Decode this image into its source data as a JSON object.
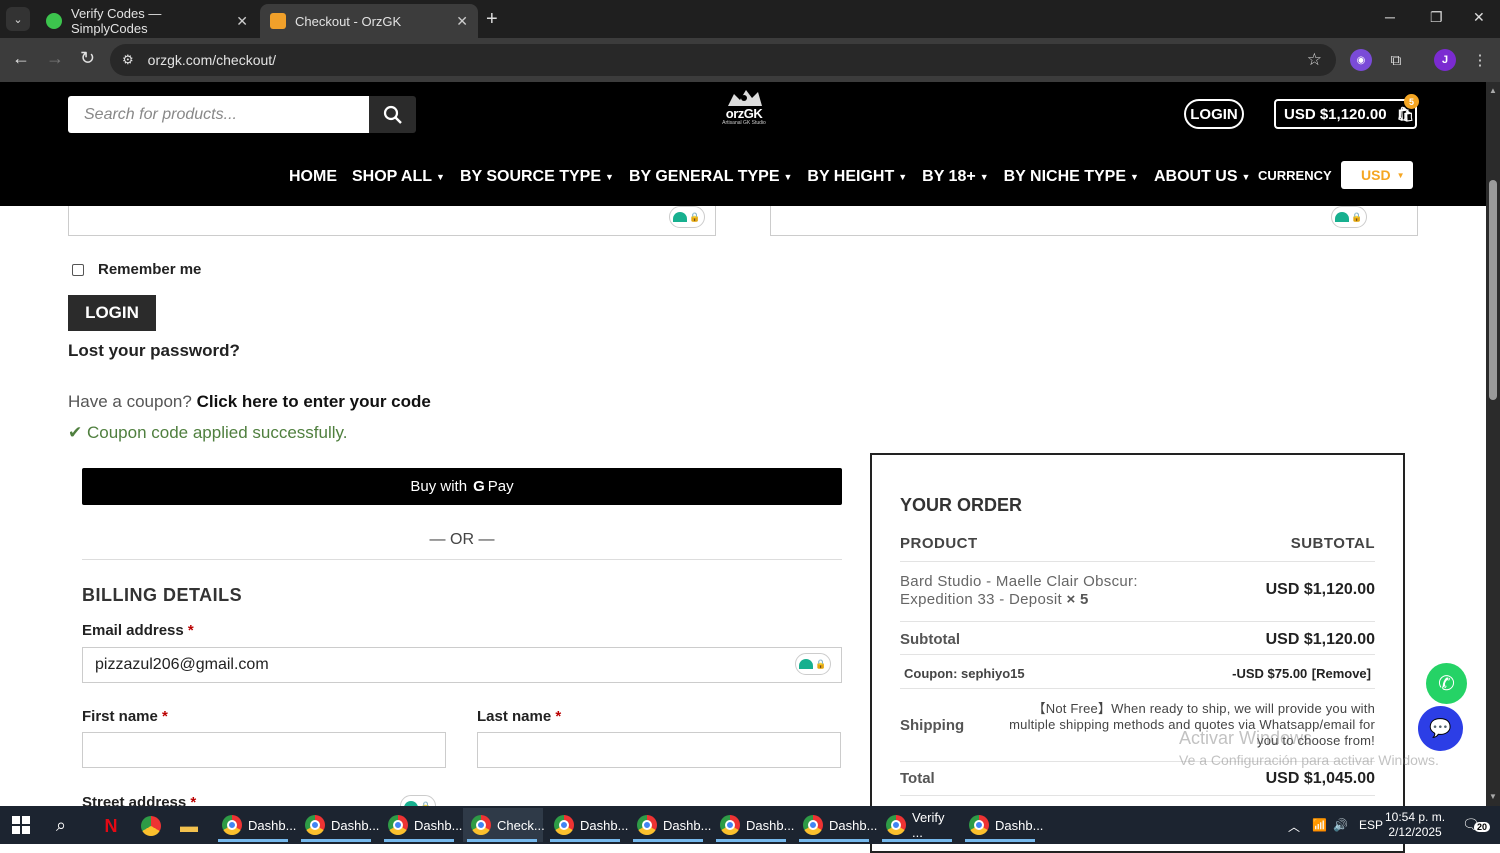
{
  "browser": {
    "tabs": [
      {
        "title": "Verify Codes — SimplyCodes",
        "favicon_color": "#3cc44d"
      },
      {
        "title": "Checkout - OrzGK",
        "favicon_color": "#f0a02a"
      }
    ],
    "url": "orzgk.com/checkout/",
    "profile_initial": "J"
  },
  "header": {
    "search_placeholder": "Search for products...",
    "logo_name": "orzGK",
    "logo_tagline": "Artisanal GK Studio",
    "login_label": "LOGIN",
    "cart_total": "USD $1,120.00",
    "cart_count": "5",
    "nav": [
      "HOME",
      "SHOP ALL",
      "BY SOURCE TYPE",
      "BY GENERAL TYPE",
      "BY HEIGHT",
      "BY 18+",
      "BY NICHE TYPE",
      "ABOUT US"
    ],
    "nav_has_caret": [
      false,
      true,
      true,
      true,
      true,
      true,
      true,
      true
    ],
    "currency_label": "CURRENCY",
    "currency_value": "USD"
  },
  "login_form": {
    "remember_label": "Remember me",
    "login_button": "LOGIN",
    "lost_password": "Lost your password?"
  },
  "coupon": {
    "question": "Have a coupon?",
    "link": "Click here to enter your code",
    "success": "Coupon code applied successfully."
  },
  "payment": {
    "gpay_prefix": "Buy with",
    "gpay_g": "G",
    "gpay_suffix": "Pay",
    "or_text": "— OR —"
  },
  "billing": {
    "title": "BILLING DETAILS",
    "email_label": "Email address",
    "email_value": "pizzazul206@gmail.com",
    "first_name_label": "First name",
    "last_name_label": "Last name",
    "street_label": "Street address",
    "required_mark": "*"
  },
  "order": {
    "title": "YOUR ORDER",
    "col_product": "PRODUCT",
    "col_subtotal": "SUBTOTAL",
    "item_name": "Bard Studio - Maelle Clair Obscur: Expedition 33 - Deposit",
    "item_qty": "× 5",
    "item_total": "USD $1,120.00",
    "subtotal_label": "Subtotal",
    "subtotal_value": "USD $1,120.00",
    "coupon_label": "Coupon: sephiyo15",
    "coupon_value": "-USD $75.00",
    "coupon_remove": "[Remove]",
    "shipping_label": "Shipping",
    "shipping_note": "【Not Free】When ready to ship, we will provide you with multiple shipping methods and quotes via Whatsapp/email for you to choose from!",
    "total_label": "Total",
    "total_value": "USD $1,045.00"
  },
  "watermark": {
    "line1": "Activar Windows",
    "line2": "Ve a Configuración para activar Windows."
  },
  "taskbar": {
    "apps": [
      {
        "label": "Dashb...",
        "badge": ""
      },
      {
        "label": "Dashb...",
        "badge": ""
      },
      {
        "label": "Dashb...",
        "badge": "A"
      },
      {
        "label": "Check...",
        "badge": "J"
      },
      {
        "label": "Dashb...",
        "badge": "H"
      },
      {
        "label": "Dashb...",
        "badge": "Y"
      },
      {
        "label": "Dashb...",
        "badge": ""
      },
      {
        "label": "Dashb...",
        "badge": ""
      },
      {
        "label": "Verify ...",
        "badge": "N"
      },
      {
        "label": "Dashb...",
        "badge": "F"
      }
    ],
    "lang": "ESP",
    "time": "10:54 p. m.",
    "date": "2/12/2025",
    "notifications": "20"
  },
  "colors": {
    "accent": "#f5a623",
    "success": "#4f7f3e",
    "header_bg": "#000000",
    "whatsapp": "#25d366",
    "chat": "#2c3ee6"
  }
}
